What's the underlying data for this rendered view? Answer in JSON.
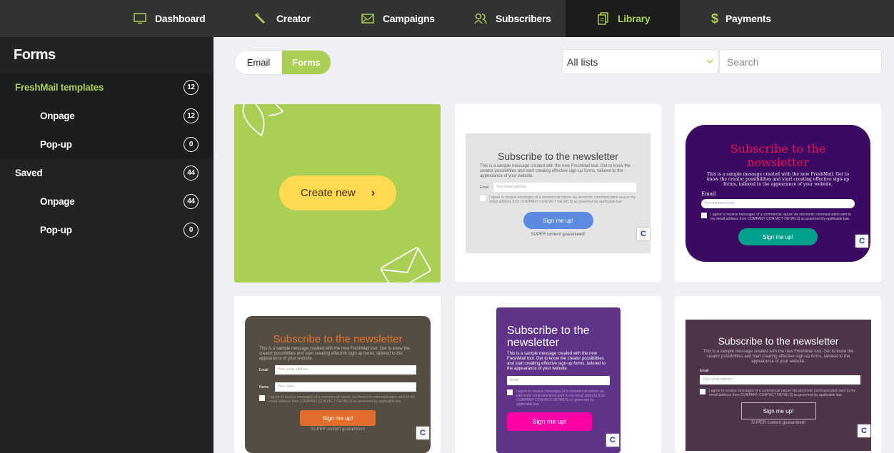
{
  "nav": {
    "items": [
      {
        "label": "Dashboard",
        "icon": "monitor-icon"
      },
      {
        "label": "Creator",
        "icon": "pencil-icon"
      },
      {
        "label": "Campaigns",
        "icon": "envelope-icon"
      },
      {
        "label": "Subscribers",
        "icon": "users-icon"
      },
      {
        "label": "Library",
        "icon": "documents-icon",
        "active": true
      },
      {
        "label": "Payments",
        "icon": "dollar-icon"
      }
    ]
  },
  "sidebar": {
    "title": "Forms",
    "groups": [
      {
        "label": "FreshMail templates",
        "count": "12",
        "children": [
          {
            "label": "Onpage",
            "count": "12"
          },
          {
            "label": "Pop-up",
            "count": "0"
          }
        ]
      },
      {
        "label": "Saved",
        "count": "44",
        "children": [
          {
            "label": "Onpage",
            "count": "44"
          },
          {
            "label": "Pop-up",
            "count": "0"
          }
        ]
      }
    ]
  },
  "toolbar": {
    "toggle": {
      "email": "Email",
      "forms": "Forms",
      "selected": "Forms"
    },
    "list_select": "All lists",
    "search_placeholder": "Search"
  },
  "create_card": {
    "label": "Create new"
  },
  "colors": {
    "accent": "#a9cf54",
    "topbar": "#333333",
    "sidebar": "#232323",
    "create_button": "#ffd94f"
  },
  "templates": [
    {
      "title": "Subscribe to the newsletter",
      "body": "This is a sample message created with the new FreshMail tool. Get to know the creator possibilities and start creating effective sign-up forms, tailored to the appearance of your website.",
      "email_label": "Email",
      "email_placeholder": "Your email address",
      "consent": "I agree to receive messages of a commercial nature via electronic communication sent to my email address from COMPANY CONTACT DETAILS] as governed by applicable law.",
      "button": "Sign me up!",
      "footer": "SUPER content guaranteed!"
    },
    {
      "title": "Subscribe to the newsletter",
      "body": "This is a sample message created with the new FreshMail. Get to know the creator possibilities and start creating effective sign-up forms, tailored to the appearance of your website.",
      "email_label": "Email",
      "email_placeholder": "Your address email",
      "consent": "I agree to receive messages of a commercial nature via electronic communication sent to my email address from COMPANY CONTACT DETAILS] as governed by applicable law.",
      "button": "Sign me up!"
    },
    {
      "title": "Subscribe to the newsletter",
      "body": "This is a sample message created with the new FreshMail tool. Get to know the creator possibilities and start creating effective sign-up forms, tailored to the appearance of your website.",
      "email_label": "Email",
      "email_placeholder": "Your email address",
      "name_label": "Name",
      "name_placeholder": "Your name",
      "consent": "I agree to receive messages of a commercial nature via electronic communication sent to my email address from COMPANY CONTACT DETAILS] as governed by applicable law.",
      "button": "Sign me up!",
      "footer": "SUPER content guaranteed!"
    },
    {
      "title": "Subscribe to the newsletter",
      "body": "This is a sample message created with the new FreshMail tool. Get to know the creator possibilities and start creating effective sign-up forms, tailored to the appearance of your website.",
      "email_placeholder": "Email",
      "consent": "I agree to receive messages of a commercial nature via electronic communication sent to my email address from COMPANY CONTACT DETAILS] as governed by applicable law.",
      "button": "Sign me up!"
    },
    {
      "title": "Subscribe to the newsletter",
      "body": "This is a sample message created with the new FreshMail tool. Get to know the creator possibilities and start creating effective sign-up forms, tailored to the appearance of your website.",
      "email_label": "Email",
      "email_placeholder": "Your email address",
      "consent": "I agree to receive messages of a commercial nature via electronic communication sent to my email address from COMPANY CONTACT DETAILS] as governed by applicable law.",
      "button": "Sign me up!",
      "footer": "SUPER content guaranteed!"
    }
  ]
}
